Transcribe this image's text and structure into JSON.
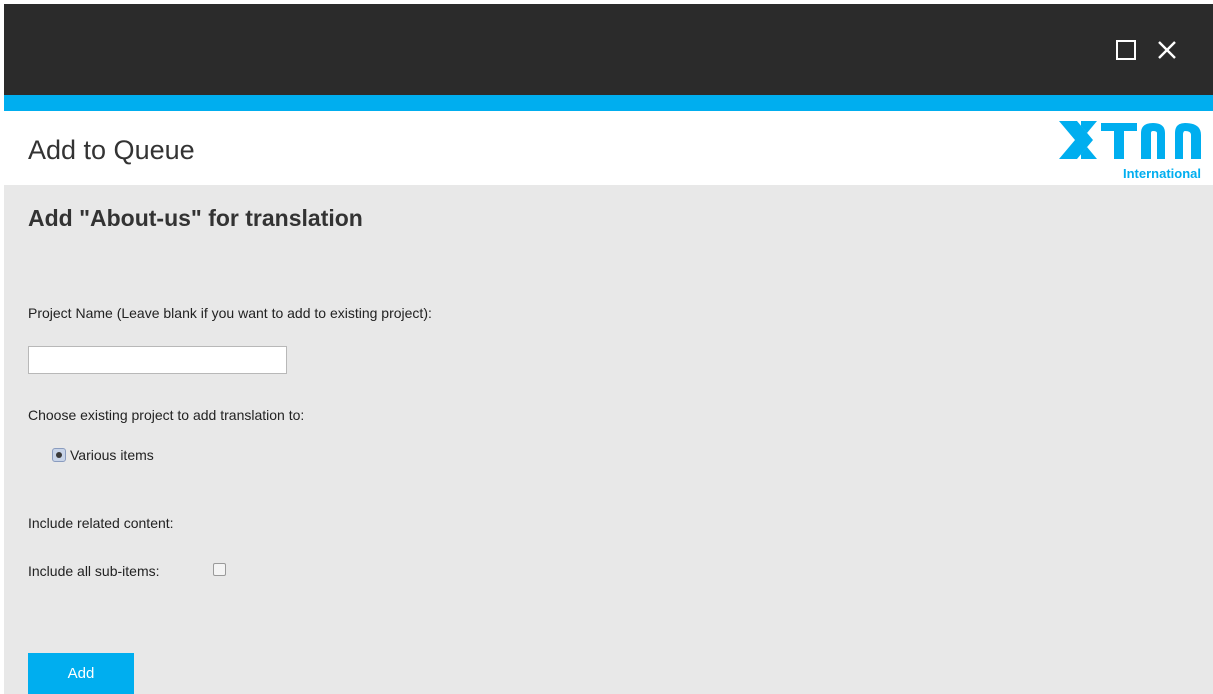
{
  "window": {
    "maximize_icon": "maximize-icon",
    "close_icon": "close-icon"
  },
  "header": {
    "title": "Add to Queue",
    "logo_text": "XTM",
    "logo_subtitle": "International"
  },
  "colors": {
    "accent": "#00aeef",
    "titlebar": "#2b2b2b",
    "content_bg": "#e8e8e8"
  },
  "form": {
    "heading": "Add \"About-us\" for translation",
    "project_name_label": "Project Name (Leave blank if you want to add to existing project):",
    "project_name_value": "",
    "existing_project_label": "Choose existing project to add translation to:",
    "existing_project_option": "Various items",
    "related_content_label": "Include related content:",
    "sub_items_label": "Include all sub-items:",
    "add_button_label": "Add"
  }
}
